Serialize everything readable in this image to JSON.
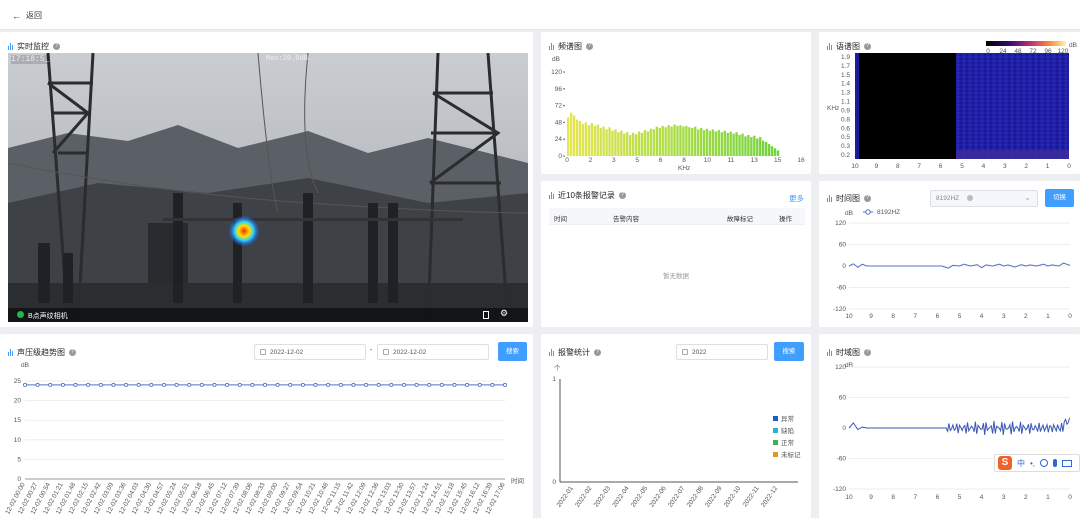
{
  "back_label": "返回",
  "monitor": {
    "title": "实时监控",
    "timestamp": "17:18:5_",
    "max_label": "Max:20.0dB",
    "camera_name": "B点声纹相机",
    "status_color": "#26b34a"
  },
  "spectrum": {
    "title": "频谱图",
    "unit": "dB",
    "xunit": "KHz",
    "chart_data": {
      "type": "bar",
      "x_ticks": [
        "0",
        "2",
        "3",
        "5",
        "6",
        "8",
        "10",
        "11",
        "13",
        "15",
        "16"
      ],
      "y_ticks": [
        "0",
        "24",
        "48",
        "72",
        "96",
        "120"
      ],
      "ylim": [
        0,
        120
      ],
      "xlim": [
        0,
        16.5
      ],
      "values": [
        55,
        62,
        58,
        52,
        50,
        46,
        48,
        44,
        47,
        43,
        45,
        40,
        42,
        38,
        41,
        36,
        38,
        34,
        36,
        32,
        34,
        30,
        33,
        31,
        35,
        33,
        37,
        35,
        39,
        38,
        42,
        40,
        43,
        41,
        44,
        42,
        45,
        43,
        44,
        42,
        43,
        41,
        40,
        42,
        38,
        40,
        37,
        39,
        36,
        38,
        35,
        37,
        34,
        36,
        33,
        35,
        32,
        34,
        30,
        32,
        28,
        30,
        27,
        29,
        25,
        27,
        22,
        20,
        17,
        14,
        11,
        8
      ]
    }
  },
  "heatmap": {
    "title": "语谱图",
    "yunit": "KHz",
    "y_ticks": [
      "0.2",
      "0.3",
      "0.5",
      "0.6",
      "0.8",
      "0.9",
      "1.1",
      "1.3",
      "1.4",
      "1.5",
      "1.7",
      "1.9"
    ],
    "x_ticks": [
      "10",
      "9",
      "8",
      "7",
      "6",
      "5",
      "4",
      "3",
      "2",
      "1",
      "0"
    ],
    "legend_ticks": [
      "0",
      "24",
      "48",
      "72",
      "96",
      "120"
    ],
    "legend_unit": "dB"
  },
  "alarms": {
    "title": "近10条报警记录",
    "more": "更多",
    "columns": [
      "时间",
      "告警内容",
      "故障标记",
      "操作"
    ],
    "empty": "暂无数据"
  },
  "timewave1": {
    "title": "时间图",
    "select_value": "8192HZ",
    "switch_label": "切换",
    "unit": "dB",
    "legend": "8192HZ",
    "chart_data": {
      "type": "line",
      "y_ticks": [
        "120",
        "60",
        "0",
        "-60",
        "-120"
      ],
      "x_ticks": [
        "10",
        "9",
        "8",
        "7",
        "6",
        "5",
        "4",
        "3",
        "2",
        "1",
        "0"
      ],
      "ylim": [
        -120,
        120
      ],
      "xlim": [
        10,
        0
      ],
      "series": [
        {
          "name": "8192HZ",
          "x": [
            10,
            9.8,
            9.6,
            9.4,
            9.2,
            9,
            8.5,
            8,
            7.5,
            7,
            6.5,
            6,
            5.8,
            5.5,
            5.3,
            5,
            4.8,
            4.5,
            4.2,
            4,
            3.8,
            3.5,
            3.2,
            3,
            2.8,
            2.5,
            2.2,
            2,
            1.8,
            1.5,
            1.2,
            1,
            0.8,
            0.5,
            0.3,
            0
          ],
          "y": [
            0,
            6,
            -4,
            5,
            0,
            0,
            0,
            0,
            0,
            0,
            0,
            0,
            0,
            -6,
            2,
            0,
            5,
            0,
            4,
            -5,
            3,
            0,
            5,
            0,
            3,
            -3,
            4,
            0,
            3,
            0,
            5,
            0,
            3,
            0,
            8,
            2
          ]
        }
      ]
    }
  },
  "trend": {
    "title": "声压级趋势图",
    "date_start": "2022-12-02",
    "date_end": "2022-12-02",
    "search_label": "搜索",
    "unit": "dB",
    "xunit": "时间",
    "chart_data": {
      "type": "line",
      "y_ticks": [
        "0",
        "5",
        "10",
        "15",
        "20",
        "25"
      ],
      "ylim": [
        0,
        25
      ],
      "x_ticks": [
        "12-02 00:00",
        "12-02 00:27",
        "12-02 00:54",
        "12-02 01:21",
        "12-02 01:48",
        "12-02 02:15",
        "12-02 02:42",
        "12-02 03:09",
        "12-02 03:36",
        "12-02 04:03",
        "12-02 04:30",
        "12-02 04:57",
        "12-02 05:24",
        "12-02 05:51",
        "12-02 06:18",
        "12-02 06:45",
        "12-02 07:12",
        "12-02 07:39",
        "12-02 08:06",
        "12-02 08:33",
        "12-02 09:00",
        "12-02 09:27",
        "12-02 09:54",
        "12-02 10:21",
        "12-02 10:48",
        "12-02 11:15",
        "12-02 11:42",
        "12-02 12:09",
        "12-02 12:36",
        "12-02 13:03",
        "12-02 13:30",
        "12-02 13:57",
        "12-02 14:24",
        "12-02 14:51",
        "12-02 15:18",
        "12-02 15:45",
        "12-02 16:12",
        "12-02 16:39",
        "12-02 17:06"
      ],
      "series": [
        {
          "name": "",
          "value": 24
        }
      ]
    }
  },
  "stats": {
    "title": "报警统计",
    "year": "2022",
    "search_label": "搜索",
    "unit": "个",
    "chart_data": {
      "type": "bar",
      "y_ticks": [
        "0",
        "1"
      ],
      "ylim": [
        0,
        1
      ],
      "categories": [
        "2022-01",
        "2022-02",
        "2022-03",
        "2022-04",
        "2022-05",
        "2022-06",
        "2022-07",
        "2022-08",
        "2022-09",
        "2022-10",
        "2022-11",
        "2022-12"
      ],
      "series": [
        {
          "name": "异常",
          "color": "#1a5fc9",
          "values": [
            0,
            0,
            0,
            0,
            0,
            0,
            0,
            0,
            0,
            0,
            0,
            0
          ]
        },
        {
          "name": "缺陷",
          "color": "#25b3d6",
          "values": [
            0,
            0,
            0,
            0,
            0,
            0,
            0,
            0,
            0,
            0,
            0,
            0
          ]
        },
        {
          "name": "正常",
          "color": "#3cb44b",
          "values": [
            0,
            0,
            0,
            0,
            0,
            0,
            0,
            0,
            0,
            0,
            0,
            0
          ]
        },
        {
          "name": "未标记",
          "color": "#e09b1f",
          "values": [
            0,
            0,
            0,
            0,
            0,
            0,
            0,
            0,
            0,
            0,
            0,
            0
          ]
        }
      ]
    }
  },
  "timedomain": {
    "title": "时域图",
    "unit": "dB",
    "chart_data": {
      "type": "line",
      "y_ticks": [
        "120",
        "60",
        "0",
        "-60",
        "-120"
      ],
      "x_ticks": [
        "10",
        "9",
        "8",
        "7",
        "6",
        "5",
        "4",
        "3",
        "2",
        "1",
        "0"
      ],
      "ylim": [
        -120,
        120
      ],
      "xlim": [
        10,
        0
      ]
    }
  },
  "ime": {
    "label": "中"
  }
}
